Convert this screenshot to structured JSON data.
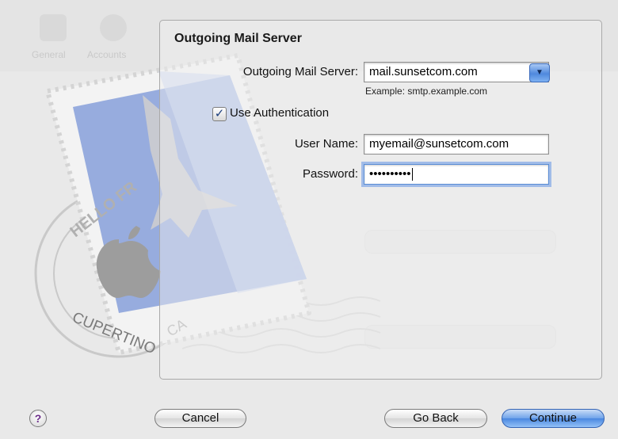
{
  "dialog": {
    "section_title": "Outgoing Mail Server",
    "server_label": "Outgoing Mail Server:",
    "server_value": "mail.sunsetcom.com",
    "server_hint": "Example: smtp.example.com",
    "use_auth_label": "Use Authentication",
    "use_auth_checked": true,
    "username_label": "User Name:",
    "username_value": "myemail@sunsetcom.com",
    "password_label": "Password:",
    "password_mask": "••••••••••"
  },
  "background": {
    "toolbar": [
      "General",
      "Accounts"
    ]
  },
  "stamp": {
    "text_top": "HELLO FR",
    "text_bottom": "CUPERTINO",
    "text_state": "CA"
  },
  "buttons": {
    "help": "?",
    "cancel": "Cancel",
    "go_back": "Go Back",
    "continue": "Continue"
  },
  "colors": {
    "accent": "#4a87e0",
    "stamp_blue": "#8fa6dc"
  }
}
